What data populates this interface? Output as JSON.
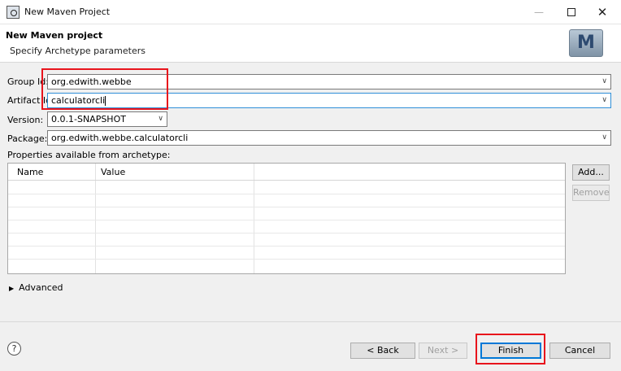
{
  "window": {
    "title": "New Maven Project",
    "minimize": "—",
    "close": "✕"
  },
  "header": {
    "title": "New Maven project",
    "subtitle": "Specify Archetype parameters",
    "logo_text": "M"
  },
  "form": {
    "group_id": {
      "label": "Group Id:",
      "value": "org.edwith.webbe"
    },
    "artifact_id": {
      "label": "Artifact Id:",
      "value": "calculatorcli"
    },
    "version": {
      "label": "Version:",
      "value": "0.0.1-SNAPSHOT"
    },
    "package": {
      "label": "Package:",
      "value": "org.edwith.webbe.calculatorcli"
    }
  },
  "properties": {
    "label": "Properties available from archetype:",
    "columns": [
      "Name",
      "Value"
    ],
    "rows": [],
    "add_label": "Add...",
    "remove_label": "Remove"
  },
  "advanced_label": "Advanced",
  "footer": {
    "help": "?",
    "back_label": "< Back",
    "next_label": "Next >",
    "finish_label": "Finish",
    "cancel_label": "Cancel"
  },
  "colors": {
    "highlight": "#e8141c",
    "focus": "#2f8fd8",
    "default_button": "#0078d7"
  },
  "icons": {
    "dropdown": "chevron-down-icon",
    "help": "help-icon",
    "expand": "triangle-right-icon"
  }
}
